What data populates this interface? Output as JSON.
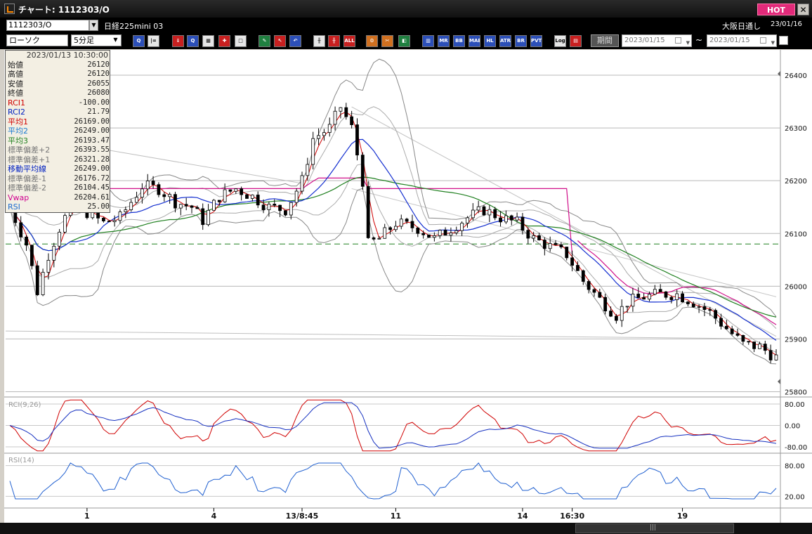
{
  "window": {
    "title": "チャート: 1112303/O",
    "hot_label": "HOT",
    "close_label": "✕"
  },
  "symbol_bar": {
    "symbol": "1112303/O",
    "name": "日経225mini 03",
    "market": "大阪日通し",
    "date": "23/01/16"
  },
  "toolbar": {
    "chart_type": "ローソク",
    "interval": "5分足",
    "buttons": [
      "zoom",
      "cursor",
      "down",
      "pointer",
      "trend",
      "rcf",
      "label",
      "pen",
      "arrow",
      "blue-arrow",
      "grid1",
      "grid2",
      "ALL",
      "gear",
      "wrench",
      "palette",
      "mm",
      "MR",
      "BB",
      "MAE",
      "HL",
      "ATR",
      "BR",
      "PVT",
      "Log",
      "save"
    ],
    "period_label": "期間",
    "date_from": "2023/01/15",
    "date_to": "2023/01/15",
    "tilde": "~"
  },
  "info_panel": {
    "datetime": "2023/01/13  10:30:00",
    "rows": [
      {
        "label": "始値",
        "value": "26120",
        "color": "#222"
      },
      {
        "label": "高値",
        "value": "26120",
        "color": "#222"
      },
      {
        "label": "安値",
        "value": "26055",
        "color": "#222"
      },
      {
        "label": "終値",
        "value": "26080",
        "color": "#222"
      },
      {
        "label": "RCI1",
        "value": "-100.00",
        "color": "#d00000"
      },
      {
        "label": "RCI2",
        "value": "21.79",
        "color": "#0020c0"
      },
      {
        "label": "平均1",
        "value": "26169.00",
        "color": "#d00000"
      },
      {
        "label": "平均2",
        "value": "26249.00",
        "color": "#1a7ad0"
      },
      {
        "label": "平均3",
        "value": "26193.47",
        "color": "#208020"
      },
      {
        "label": "標準偏差+2",
        "value": "26393.55",
        "color": "#777"
      },
      {
        "label": "標準偏差+1",
        "value": "26321.28",
        "color": "#777"
      },
      {
        "label": "移動平均線",
        "value": "26249.00",
        "color": "#0020c0"
      },
      {
        "label": "標準偏差-1",
        "value": "26176.72",
        "color": "#777"
      },
      {
        "label": "標準偏差-2",
        "value": "26104.45",
        "color": "#777"
      },
      {
        "label": "Vwap",
        "value": "26204.61",
        "color": "#d00090"
      },
      {
        "label": "RSI",
        "value": "25.00",
        "color": "#1a6ad0"
      }
    ]
  },
  "colors": {
    "ma1": "#d00000",
    "ma2": "#1530d0",
    "ma3": "#208020",
    "bb2": "#888888",
    "bb1": "#aaaaaa",
    "vwap": "#d0108a",
    "rci1": "#d00000",
    "rci2": "#1530c0",
    "rsi": "#2060d0",
    "ref_line": "#208020"
  },
  "chart_data": {
    "type": "candlestick",
    "price_axis": {
      "ticks": [
        25800,
        25900,
        26000,
        26100,
        26200,
        26300,
        26400
      ],
      "range": [
        25790,
        26440
      ]
    },
    "reference_line": 26080,
    "x_ticks": [
      {
        "label": "1",
        "i": 14
      },
      {
        "label": "4",
        "i": 37
      },
      {
        "label": "13/8:45",
        "i": 53
      },
      {
        "label": "11",
        "i": 70
      },
      {
        "label": "14",
        "i": 93
      },
      {
        "label": "16:30",
        "i": 102
      },
      {
        "label": "19",
        "i": 122
      }
    ],
    "num_bars": 140,
    "anchors": [
      [
        0,
        26150
      ],
      [
        3,
        26080
      ],
      [
        5,
        25990
      ],
      [
        7,
        26060
      ],
      [
        9,
        26110
      ],
      [
        11,
        26150
      ],
      [
        14,
        26140
      ],
      [
        17,
        26120
      ],
      [
        20,
        26130
      ],
      [
        24,
        26190
      ],
      [
        27,
        26185
      ],
      [
        30,
        26160
      ],
      [
        33,
        26150
      ],
      [
        35,
        26125
      ],
      [
        38,
        26170
      ],
      [
        41,
        26185
      ],
      [
        44,
        26170
      ],
      [
        47,
        26150
      ],
      [
        50,
        26145
      ],
      [
        53,
        26200
      ],
      [
        55,
        26280
      ],
      [
        58,
        26300
      ],
      [
        60,
        26340
      ],
      [
        62,
        26300
      ],
      [
        64,
        26200
      ],
      [
        65,
        26080
      ],
      [
        67,
        26090
      ],
      [
        70,
        26120
      ],
      [
        74,
        26110
      ],
      [
        77,
        26090
      ],
      [
        80,
        26110
      ],
      [
        83,
        26130
      ],
      [
        86,
        26145
      ],
      [
        89,
        26130
      ],
      [
        92,
        26120
      ],
      [
        95,
        26090
      ],
      [
        98,
        26075
      ],
      [
        101,
        26060
      ],
      [
        104,
        26010
      ],
      [
        107,
        25975
      ],
      [
        110,
        25945
      ],
      [
        112,
        25970
      ],
      [
        115,
        25980
      ],
      [
        118,
        25985
      ],
      [
        121,
        25985
      ],
      [
        124,
        25970
      ],
      [
        127,
        25950
      ],
      [
        130,
        25920
      ],
      [
        133,
        25890
      ],
      [
        136,
        25885
      ],
      [
        139,
        25865
      ]
    ],
    "rci_panel": {
      "label": "RCI(9,26)",
      "ticks": [
        "80.00",
        "0.00",
        "-80.00"
      ]
    },
    "rsi_panel": {
      "label": "RSI(14)",
      "ticks": [
        "80.00",
        "20.00"
      ]
    }
  }
}
